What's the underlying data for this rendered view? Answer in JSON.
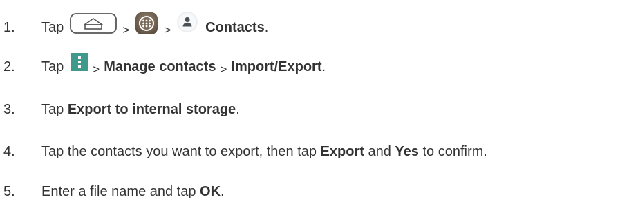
{
  "steps": [
    {
      "number": "1.",
      "tap": "Tap",
      "sep1": ">",
      "sep2": ">",
      "target": "Contacts",
      "end": ".",
      "icons": [
        "home-icon",
        "apps-icon",
        "contacts-icon"
      ]
    },
    {
      "number": "2.",
      "tap": "Tap",
      "sep1": ">",
      "item1": "Manage contacts",
      "sep2": ">",
      "item2": "Import/Export",
      "end": ".",
      "icons": [
        "menu-icon"
      ]
    },
    {
      "number": "3.",
      "tap": "Tap ",
      "target": "Export to internal storage",
      "end": "."
    },
    {
      "number": "4.",
      "text1": "Tap the contacts you want to export, then tap ",
      "bold1": "Export",
      "text2": " and ",
      "bold2": "Yes",
      "text3": " to confirm."
    },
    {
      "number": "5.",
      "text1": "Enter a file name and tap ",
      "bold1": "OK",
      "end": "."
    }
  ],
  "colors": {
    "text": "#333333",
    "menu_icon_bg": "#3f9a8c",
    "apps_icon_bg": "#7a6a58"
  }
}
